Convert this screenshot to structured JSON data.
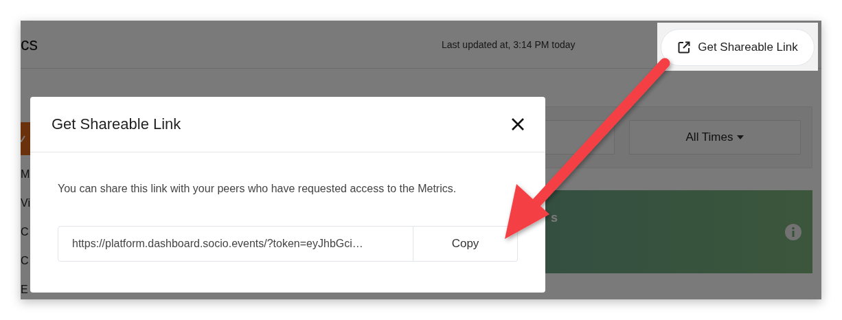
{
  "page": {
    "title": "cs",
    "last_updated": "Last updated at, 3:14 PM today",
    "share_button": {
      "label": "Get Shareable Link",
      "highlighted": true
    }
  },
  "sidebar": {
    "items": [
      {
        "label": "M"
      },
      {
        "label": "Vi"
      },
      {
        "label": "C"
      },
      {
        "label": "C"
      },
      {
        "label": "E"
      }
    ]
  },
  "filters": [
    {
      "kind": "blank"
    },
    {
      "kind": "select",
      "label": "All Times"
    }
  ],
  "card": {
    "title": "s"
  },
  "modal": {
    "title": "Get Shareable Link",
    "message": "You can share this link with your peers who have requested access to the Metrics.",
    "link": "https://platform.dashboard.socio.events/?token=eyJhbGci…",
    "copy_button": "Copy"
  }
}
